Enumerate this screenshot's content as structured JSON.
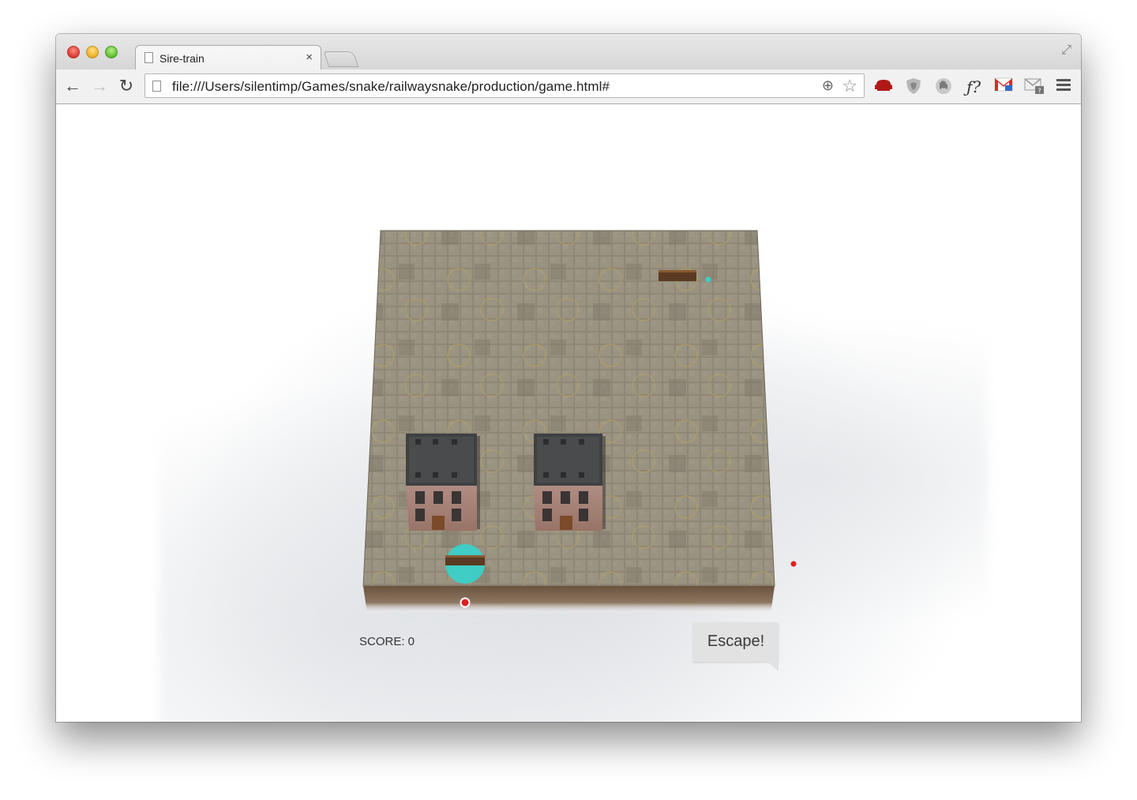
{
  "browser": {
    "tab_title": "Sire-train",
    "tab_close": "×",
    "url": "file:///Users/silentimp/Games/snake/railwaysnake/production/game.html#",
    "back_glyph": "←",
    "forward_glyph": "→",
    "reload_glyph": "↻",
    "extensions": [
      "sofa-icon",
      "shield-icon",
      "hand-icon",
      "fonts-icon",
      "gmail-icon",
      "mail-checker-icon",
      "menu-icon"
    ]
  },
  "game": {
    "score_label": "SCORE: 0",
    "bubble_text": "Escape!",
    "colors": {
      "ground": "#8a826f",
      "wall": "#6b5a4a",
      "roof": "#3f4042",
      "brick": "#a6827a",
      "train_head": "#3ad0c8",
      "train_car": "#5a3a22",
      "food": "#e02020"
    }
  }
}
